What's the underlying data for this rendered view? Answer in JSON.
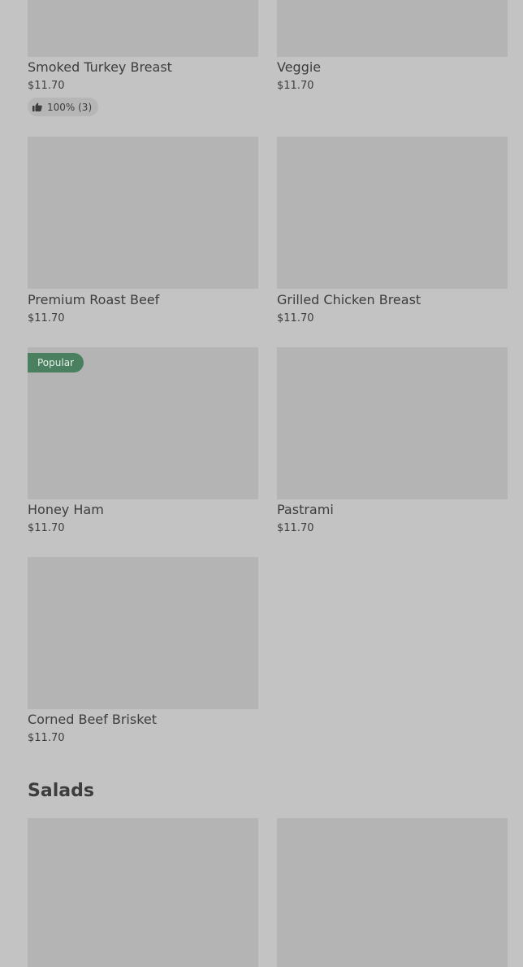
{
  "items": [
    {
      "name": "Smoked Turkey Breast",
      "price": "$11.70",
      "rating": "100% (3)"
    },
    {
      "name": "Veggie",
      "price": "$11.70"
    },
    {
      "name": "Premium Roast Beef",
      "price": "$11.70"
    },
    {
      "name": "Grilled Chicken Breast",
      "price": "$11.70"
    },
    {
      "name": "Honey Ham",
      "price": "$11.70",
      "badge": "Popular"
    },
    {
      "name": "Pastrami",
      "price": "$11.70"
    },
    {
      "name": "Corned Beef Brisket",
      "price": "$11.70"
    }
  ],
  "sections": {
    "salads_title": "Salads"
  },
  "colors": {
    "overlay_bg": "#c3c3c3",
    "thumb_bg": "#b4b4b4",
    "badge_bg": "#4a8060"
  },
  "icons": {
    "rating": "thumbs-up-icon"
  }
}
